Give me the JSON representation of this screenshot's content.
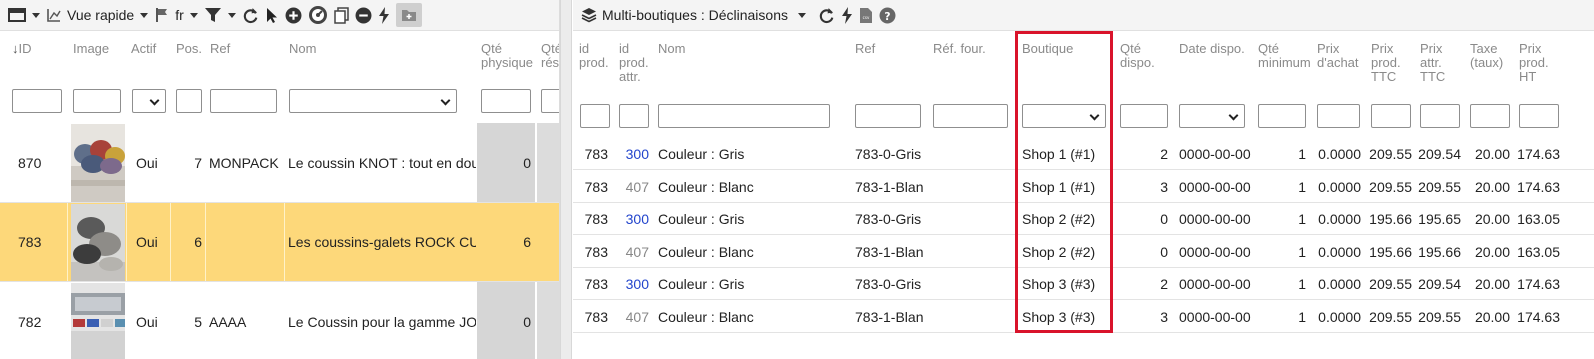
{
  "left_panel": {
    "toolbar": {
      "view_label": "Vue rapide",
      "lang_label": "fr"
    },
    "columns": [
      "ID",
      "Image",
      "Actif",
      "Pos.",
      "Ref",
      "Nom",
      "Qté\nphysique",
      "Qté\nrés"
    ],
    "rows": [
      {
        "id": "870",
        "actif": "Oui",
        "pos": "7",
        "ref": "MONPACK",
        "nom": "Le coussin KNOT : tout en dou",
        "qty": "0",
        "selected": false
      },
      {
        "id": "783",
        "actif": "Oui",
        "pos": "6",
        "ref": "",
        "nom": "Les coussins-galets ROCK CU",
        "qty": "6",
        "selected": true
      },
      {
        "id": "782",
        "actif": "Oui",
        "pos": "5",
        "ref": "AAAA",
        "nom": "Le Coussin pour la gamme JOI",
        "qty": "0",
        "selected": false
      }
    ]
  },
  "right_panel": {
    "toolbar": {
      "title": "Multi-boutiques : Déclinaisons"
    },
    "columns": {
      "id_prod": "id\nprod.",
      "id_prod_attr": "id\nprod.\nattr.",
      "nom": "Nom",
      "ref": "Ref",
      "ref_four": "Réf. four.",
      "boutique": "Boutique",
      "qte_dispo": "Qté\ndispo.",
      "date_dispo": "Date dispo.",
      "qte_min": "Qté\nminimum",
      "prix_achat": "Prix\nd'achat",
      "prix_prod_ttc": "Prix\nprod.\nTTC",
      "prix_attr_ttc": "Prix\nattr.\nTTC",
      "taxe": "Taxe\n(taux)",
      "prix_prod_ht": "Prix\nprod.\nHT"
    },
    "rows": [
      {
        "id_prod": "783",
        "id_attr": "300",
        "attr_link": "blue",
        "nom": "Couleur : Gris",
        "ref": "783-0-Gris",
        "boutique": "Shop 1 (#1)",
        "qte": "2",
        "date": "0000-00-00",
        "min": "1",
        "achat": "0.0000",
        "prod_ttc": "209.55",
        "attr_ttc": "209.54",
        "taxe": "20.00",
        "prod_ht": "174.63"
      },
      {
        "id_prod": "783",
        "id_attr": "407",
        "attr_link": "gray",
        "nom": "Couleur : Blanc",
        "ref": "783-1-Blan",
        "boutique": "Shop 1 (#1)",
        "qte": "3",
        "date": "0000-00-00",
        "min": "1",
        "achat": "0.0000",
        "prod_ttc": "209.55",
        "attr_ttc": "209.55",
        "taxe": "20.00",
        "prod_ht": "174.63"
      },
      {
        "id_prod": "783",
        "id_attr": "300",
        "attr_link": "blue",
        "nom": "Couleur : Gris",
        "ref": "783-0-Gris",
        "boutique": "Shop 2 (#2)",
        "qte": "0",
        "date": "0000-00-00",
        "min": "1",
        "achat": "0.0000",
        "prod_ttc": "195.66",
        "attr_ttc": "195.65",
        "taxe": "20.00",
        "prod_ht": "163.05"
      },
      {
        "id_prod": "783",
        "id_attr": "407",
        "attr_link": "gray",
        "nom": "Couleur : Blanc",
        "ref": "783-1-Blan",
        "boutique": "Shop 2 (#2)",
        "qte": "0",
        "date": "0000-00-00",
        "min": "1",
        "achat": "0.0000",
        "prod_ttc": "195.66",
        "attr_ttc": "195.66",
        "taxe": "20.00",
        "prod_ht": "163.05"
      },
      {
        "id_prod": "783",
        "id_attr": "300",
        "attr_link": "blue",
        "nom": "Couleur : Gris",
        "ref": "783-0-Gris",
        "boutique": "Shop 3 (#3)",
        "qte": "2",
        "date": "0000-00-00",
        "min": "1",
        "achat": "0.0000",
        "prod_ttc": "209.55",
        "attr_ttc": "209.54",
        "taxe": "20.00",
        "prod_ht": "174.63"
      },
      {
        "id_prod": "783",
        "id_attr": "407",
        "attr_link": "gray",
        "nom": "Couleur : Blanc",
        "ref": "783-1-Blan",
        "boutique": "Shop 3 (#3)",
        "qte": "3",
        "date": "0000-00-00",
        "min": "1",
        "achat": "0.0000",
        "prod_ttc": "209.55",
        "attr_ttc": "209.55",
        "taxe": "20.00",
        "prod_ht": "174.63"
      }
    ]
  },
  "colors": {
    "selected_row": "#fdd87a",
    "highlight_frame": "#d9132b",
    "link_blue": "#2244cc"
  },
  "icons": {
    "left_toolbar": [
      "grid-menu-icon",
      "chart-view-icon",
      "flag-icon",
      "filter-icon",
      "refresh-icon",
      "cursor-icon",
      "plus-circle-icon",
      "speed-icon",
      "copy-icon",
      "minus-circle-icon",
      "bolt-icon",
      "folder-add-icon"
    ],
    "right_toolbar": [
      "layers-icon",
      "refresh-icon",
      "bolt-icon",
      "csv-icon",
      "help-icon"
    ]
  }
}
